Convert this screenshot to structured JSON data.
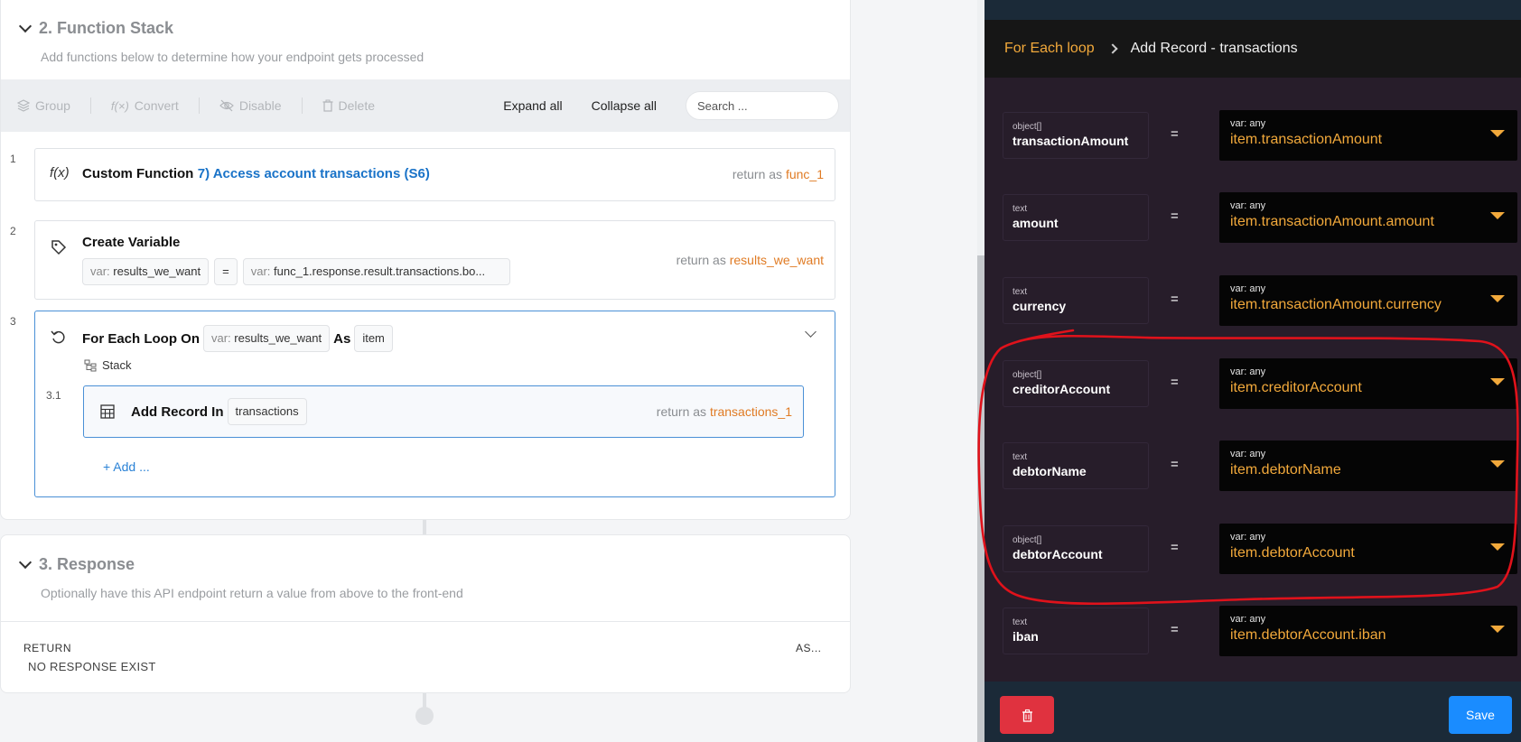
{
  "function_stack": {
    "title": "2. Function Stack",
    "subtitle": "Add functions below to determine how your endpoint gets processed",
    "toolbar": {
      "group": "Group",
      "convert": "Convert",
      "disable": "Disable",
      "delete": "Delete",
      "expand_all": "Expand all",
      "collapse_all": "Collapse all",
      "search_placeholder": "Search ..."
    },
    "steps": [
      {
        "num": "1",
        "icon_text": "f(x)",
        "label": "Custom Function",
        "link": "7) Access account transactions (S6)",
        "return_prefix": "return as",
        "return_name": "func_1"
      },
      {
        "num": "2",
        "label": "Create Variable",
        "var_prefix": "var:",
        "var_name": "results_we_want",
        "eq": "=",
        "value_prefix": "var:",
        "value": "func_1.response.result.transactions.bo...",
        "return_prefix": "return as",
        "return_name": "results_we_want"
      },
      {
        "num": "3",
        "label": "For Each Loop On",
        "var_prefix": "var:",
        "var_name": "results_we_want",
        "as_label": "As",
        "as_value": "item",
        "stack_label": "Stack",
        "substep": {
          "num": "3.1",
          "label": "Add Record In",
          "table": "transactions",
          "return_prefix": "return as",
          "return_name": "transactions_1"
        },
        "add_label": "+ Add ..."
      }
    ]
  },
  "response": {
    "title": "3. Response",
    "subtitle": "Optionally have this API endpoint return a value from above to the front-end",
    "return_col": "RETURN",
    "as_col": "AS...",
    "empty": "NO RESPONSE EXIST"
  },
  "panel": {
    "breadcrumb_parent": "For Each loop",
    "breadcrumb_current": "Add Record - transactions",
    "fields": [
      {
        "type": "object[]",
        "name": "transactionAmount",
        "eq": "=",
        "var": "var: any",
        "expr": "item.transactionAmount"
      },
      {
        "type": "text",
        "name": "amount",
        "eq": "=",
        "var": "var: any",
        "expr": "item.transactionAmount.amount"
      },
      {
        "type": "text",
        "name": "currency",
        "eq": "=",
        "var": "var: any",
        "expr": "item.transactionAmount.currency"
      },
      {
        "type": "object[]",
        "name": "creditorAccount",
        "eq": "=",
        "var": "var: any",
        "expr": "item.creditorAccount"
      },
      {
        "type": "text",
        "name": "debtorName",
        "eq": "=",
        "var": "var: any",
        "expr": "item.debtorName"
      },
      {
        "type": "object[]",
        "name": "debtorAccount",
        "eq": "=",
        "var": "var: any",
        "expr": "item.debtorAccount"
      },
      {
        "type": "text",
        "name": "iban",
        "eq": "=",
        "var": "var: any",
        "expr": "item.debtorAccount.iban"
      }
    ],
    "save_label": "Save"
  },
  "colors": {
    "accent_orange": "#f2a93b",
    "return_orange": "#e07b24",
    "link_blue": "#1a73c8",
    "save_blue": "#1a8cff",
    "delete_red": "#e0323f",
    "annotation_red": "#e0121b"
  }
}
